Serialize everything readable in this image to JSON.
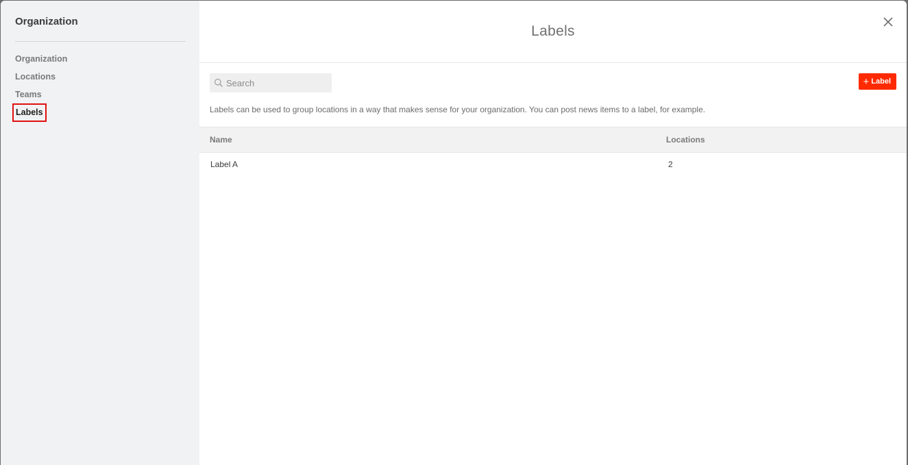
{
  "sidebar": {
    "title": "Organization",
    "items": [
      {
        "label": "Organization",
        "active": false
      },
      {
        "label": "Locations",
        "active": false
      },
      {
        "label": "Teams",
        "active": false
      },
      {
        "label": "Labels",
        "active": true
      }
    ]
  },
  "header": {
    "title": "Labels",
    "close_icon": "close-icon"
  },
  "toolbar": {
    "search_placeholder": "Search",
    "search_value": "",
    "add_button_icon": "+",
    "add_button_label": "Label",
    "description": "Labels can be used to group locations in a way that makes sense for your organization. You can post news items to a label, for example."
  },
  "table": {
    "columns": [
      "Name",
      "Locations"
    ],
    "rows": [
      {
        "name": "Label A",
        "locations": "2"
      }
    ]
  },
  "colors": {
    "accent": "#ff2a00",
    "sidebar_bg": "#f1f2f4",
    "active_outline": "#e01010"
  }
}
